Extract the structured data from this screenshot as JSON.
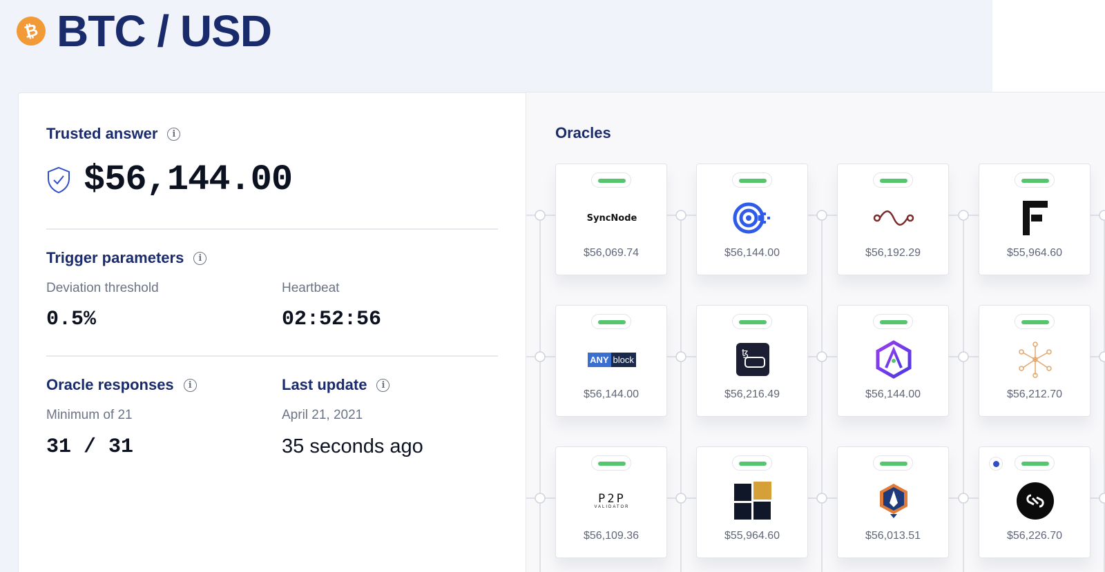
{
  "header": {
    "pair": "BTC / USD",
    "coin_symbol": "₿"
  },
  "trusted": {
    "label": "Trusted answer",
    "value": "$56,144.00"
  },
  "trigger": {
    "label": "Trigger parameters",
    "deviation_label": "Deviation threshold",
    "deviation_value": "0.5%",
    "heartbeat_label": "Heartbeat",
    "heartbeat_value": "02:52:56"
  },
  "responses": {
    "label": "Oracle responses",
    "min_label": "Minimum of 21",
    "value": "31 / 31"
  },
  "update": {
    "label": "Last update",
    "date": "April 21, 2021",
    "ago": "35 seconds ago"
  },
  "oracles": {
    "title": "Oracles",
    "items": [
      {
        "name": "SyncNode",
        "price": "$56,069.74"
      },
      {
        "name": "Chainlayer",
        "price": "$56,144.00"
      },
      {
        "name": "Oracle wave",
        "price": "$56,192.29"
      },
      {
        "name": "Fiews",
        "price": "$55,964.60"
      },
      {
        "name": "ANYblock",
        "price": "$56,144.00"
      },
      {
        "name": "Tezos wallet",
        "price": "$56,216.49"
      },
      {
        "name": "Alpha",
        "price": "$56,144.00"
      },
      {
        "name": "Network nodes",
        "price": "$56,212.70"
      },
      {
        "name": "P2P Validator",
        "price": "$56,109.36"
      },
      {
        "name": "Blocks",
        "price": "$55,964.60"
      },
      {
        "name": "Shield pen",
        "price": "$56,013.51"
      },
      {
        "name": "Chain link",
        "price": "$56,226.70"
      }
    ],
    "anyblock_text_1": "ANY",
    "anyblock_text_2": "block",
    "syncnode_text": "SyncNode",
    "p2p_text": "P2P",
    "p2p_sub": "VALIDATOR"
  },
  "colors": {
    "accent": "#1a2b6b",
    "status_green": "#55c56e",
    "bitcoin": "#f19a37"
  }
}
